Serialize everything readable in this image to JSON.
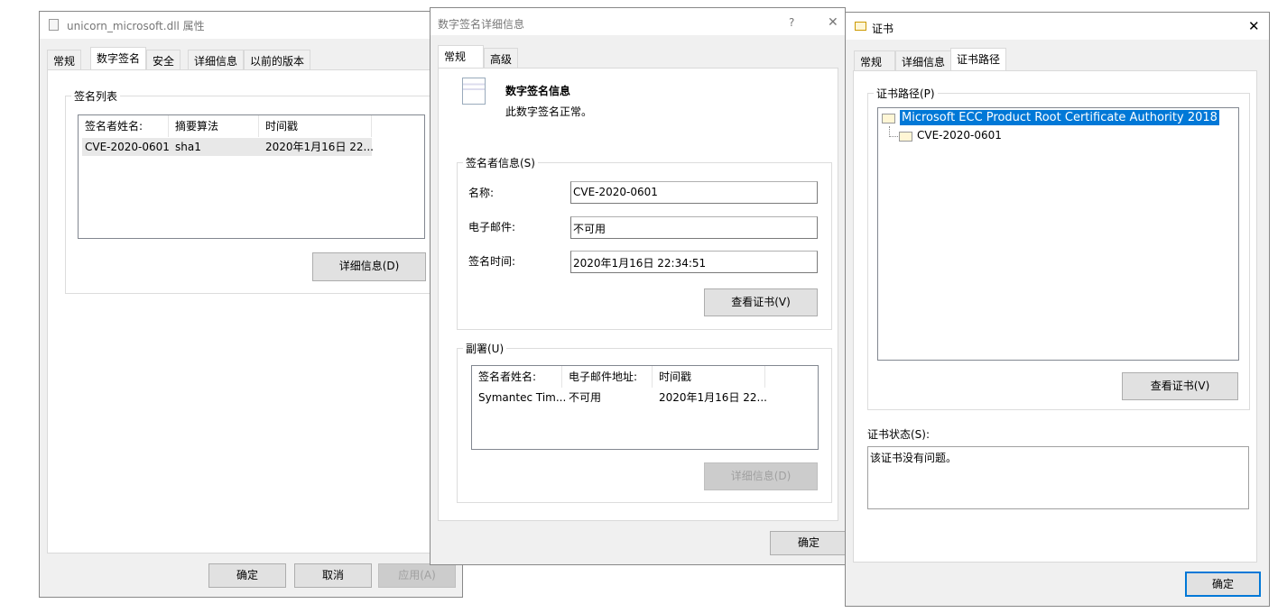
{
  "props": {
    "title": "unicorn_microsoft.dll 属性",
    "tabs": [
      "常规",
      "数字签名",
      "安全",
      "详细信息",
      "以前的版本"
    ],
    "group": "签名列表",
    "columns": [
      "签名者姓名:",
      "摘要算法",
      "时间戳"
    ],
    "row": [
      "CVE-2020-0601",
      "sha1",
      "2020年1月16日 22..."
    ],
    "details": "详细信息(D)",
    "ok": "确定",
    "cancel": "取消",
    "apply": "应用(A)"
  },
  "sig": {
    "title": "数字签名详细信息",
    "help": "?",
    "close": "✕",
    "tabs": [
      "常规",
      "高级"
    ],
    "info_title": "数字签名信息",
    "info_status": "此数字签名正常。",
    "signer_group": "签名者信息(S)",
    "name_label": "名称:",
    "name": "CVE-2020-0601",
    "email_label": "电子邮件:",
    "email": "不可用",
    "time_label": "签名时间:",
    "time": "2020年1月16日 22:34:51",
    "view_cert": "查看证书(V)",
    "counter_group": "副署(U)",
    "columns": [
      "签名者姓名:",
      "电子邮件地址:",
      "时间戳"
    ],
    "row": [
      "Symantec Tim...",
      "不可用",
      "2020年1月16日 22..."
    ],
    "details": "详细信息(D)",
    "ok": "确定"
  },
  "cert": {
    "title": "证书",
    "close": "✕",
    "tabs": [
      "常规",
      "详细信息",
      "证书路径"
    ],
    "path_group": "证书路径(P)",
    "tree": [
      "Microsoft ECC Product Root Certificate Authority 2018",
      "CVE-2020-0601"
    ],
    "view_cert": "查看证书(V)",
    "status_label": "证书状态(S):",
    "status": "该证书没有问题。",
    "ok": "确定"
  }
}
